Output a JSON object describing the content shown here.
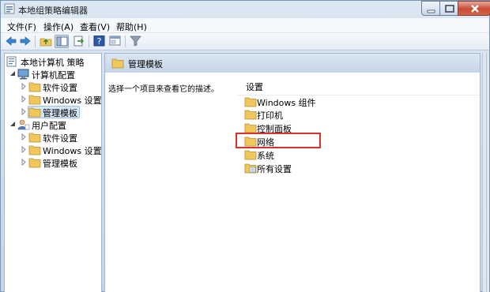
{
  "window": {
    "title": "本地组策略编辑器"
  },
  "menu": [
    {
      "label": "文件(F)"
    },
    {
      "label": "操作(A)"
    },
    {
      "label": "查看(V)"
    },
    {
      "label": "帮助(H)"
    }
  ],
  "toolbar": {
    "icons": [
      "back-arrow",
      "forward-arrow",
      "up-folder",
      "show-hide-tree",
      "export-list",
      "help",
      "properties",
      "filter"
    ]
  },
  "tree": {
    "root": "本地计算机 策略",
    "computer_config": "计算机配置",
    "computer_children": [
      "软件设置",
      "Windows 设置",
      "管理模板"
    ],
    "selected_index": 2,
    "user_config": "用户配置",
    "user_children": [
      "软件设置",
      "Windows 设置",
      "管理模板"
    ]
  },
  "content": {
    "header_title": "管理模板",
    "description": "选择一个项目来查看它的描述。",
    "column_header": "设置",
    "items": [
      {
        "label": "Windows 组件",
        "icon": "folder"
      },
      {
        "label": "打印机",
        "icon": "folder"
      },
      {
        "label": "控制面板",
        "icon": "folder"
      },
      {
        "label": "网络",
        "icon": "folder"
      },
      {
        "label": "系统",
        "icon": "folder"
      },
      {
        "label": "所有设置",
        "icon": "settings-folder"
      }
    ],
    "highlighted_index": 3
  },
  "colors": {
    "highlight": "#d9312b",
    "selection": "#d5e6f7",
    "folder": "#f0c75a"
  }
}
